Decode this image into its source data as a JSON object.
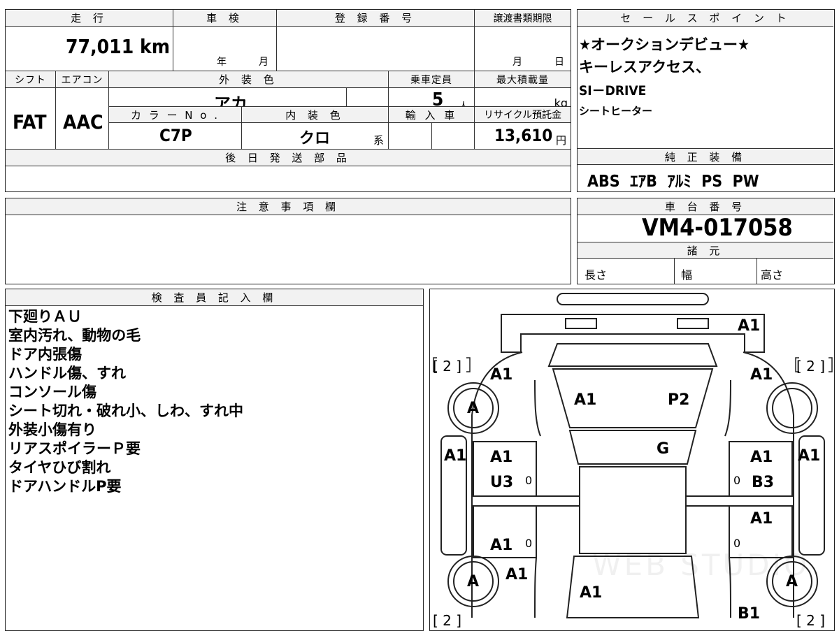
{
  "header": {
    "mileage_label": "走 行",
    "mileage_value": "77,011 km",
    "inspection_label": "車 検",
    "inspection_year": "年",
    "inspection_month": "月",
    "registration_label": "登 録 番 号",
    "transfer_label": "譲渡書類期限",
    "transfer_month": "月",
    "transfer_day": "日"
  },
  "specs": {
    "shift_label": "シフト",
    "shift_value": "FAT",
    "ac_label": "エアコン",
    "ac_value": "AAC",
    "exterior_label": "外 装 色",
    "exterior_value": "アカ",
    "capacity_label": "乗車定員",
    "capacity_value": "5",
    "capacity_unit": "人",
    "max_load_label": "最大積載量",
    "max_load_unit": "kg",
    "color_no_label": "カ ラ ー N o .",
    "color_no_value": "C7P",
    "interior_label": "内 装 色",
    "interior_value": "クロ",
    "interior_suffix": "系",
    "import_label": "輸 入 車",
    "recycle_label": "リサイクル預託金",
    "recycle_value": "13,610",
    "recycle_unit": "円"
  },
  "later_parts": {
    "label": "後 日 発 送 部 品"
  },
  "sales_points": {
    "label": "セ ー ル ス ポ イ ン ト",
    "lines": [
      "★オークションデビュー★",
      "キーレスアクセス、",
      "SI－DRIVE",
      "シートヒーター"
    ]
  },
  "equipment": {
    "label": "純 正 装 備",
    "value": "ABS  ｴｱB  ｱﾙﾐ  PS  PW"
  },
  "notes": {
    "label": "注 意 事 項 欄"
  },
  "chassis": {
    "label": "車 台 番 号",
    "value": "VM4-017058"
  },
  "dimensions": {
    "label": "諸 元",
    "length": "長さ",
    "width": "幅",
    "height": "高さ"
  },
  "inspector": {
    "label": "検 査 員 記 入 欄",
    "lines": [
      "下廻りＡＵ",
      "室内汚れ、動物の毛",
      "ドア内張傷",
      "ハンドル傷、すれ",
      "コンソール傷",
      "シート切れ・破れ小、しわ、すれ中",
      "外装小傷有り",
      "リアスポイラーＰ要",
      "タイヤひび割れ",
      "ドアハンドルP要"
    ]
  },
  "diagram": {
    "tire_count": "[ 2 ]",
    "tire_grade": "A",
    "labels": {
      "rear_bumper": "A1",
      "rear_left_quarter": "A1",
      "rear_right_quarter": "A1",
      "trunk": "A1",
      "rear_glass": "P2",
      "roof": "G",
      "left_side_rear": "A1",
      "left_rear_door": "A1",
      "left_rear_door_2": "U3",
      "left_front_door": "A1",
      "left_fender": "A1",
      "right_side_rear": "A1",
      "right_rear_door": "A1",
      "right_rear_door_2": "B3",
      "right_front_door": "A1",
      "right_side": "A1",
      "hood": "A1",
      "front_bumper": "B1",
      "zero_mark": "0"
    },
    "watermark": "WEB STUDIO"
  }
}
